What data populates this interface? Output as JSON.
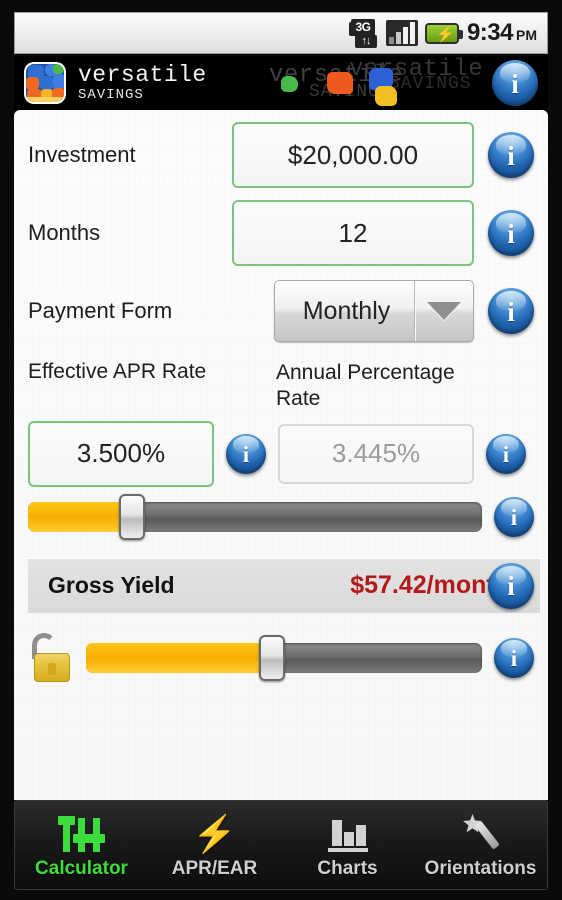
{
  "statusbar": {
    "network_icon": "3g-icon",
    "network_label": "3G",
    "signal_icon": "signal-bars-icon",
    "battery_icon": "battery-charging-icon",
    "time": "9:34",
    "ampm": "PM"
  },
  "header": {
    "logo_icon": "app-logo-icon",
    "brand_line1": "versatile",
    "brand_line2": "SAVINGS",
    "ghost_line1": "versatile",
    "ghost_line2": "SAVINGS",
    "ghost_line3": "versatile",
    "ghost_line4": "SAVINGS",
    "info_icon": "info-icon"
  },
  "form": {
    "investment": {
      "label": "Investment",
      "value": "$20,000.00",
      "info_icon": "info-icon"
    },
    "months": {
      "label": "Months",
      "value": "12",
      "info_icon": "info-icon"
    },
    "payment_form": {
      "label": "Payment Form",
      "value": "Monthly",
      "dropdown_icon": "chevron-down-icon",
      "info_icon": "info-icon",
      "options": [
        "Monthly"
      ]
    },
    "effective_apr": {
      "label": "Effective APR Rate",
      "value": "3.500%",
      "info_icon": "info-icon"
    },
    "annual_percentage": {
      "label": "Annual Percentage Rate",
      "value": "3.445%",
      "info_icon": "info-icon"
    },
    "rate_slider": {
      "name": "rate-slider",
      "percent": 23,
      "fill_color": "#F5AE00",
      "track_color": "#6D6D6D",
      "info_icon": "info-icon"
    },
    "gross_yield": {
      "label": "Gross Yield",
      "value": "$57.42/month",
      "value_color": "#B31919",
      "info_icon": "info-icon"
    },
    "lock_slider": {
      "lock_icon": "unlocked-padlock-icon",
      "percent": 47,
      "fill_color": "#F5AE00",
      "track_color": "#6D6D6D",
      "info_icon": "info-icon"
    }
  },
  "tabbar": {
    "tabs": [
      {
        "label": "Calculator",
        "icon": "faders-icon",
        "active": true
      },
      {
        "label": "APR/EAR",
        "icon": "lightning-icon",
        "active": false
      },
      {
        "label": "Charts",
        "icon": "bar-chart-icon",
        "active": false
      },
      {
        "label": "Orientations",
        "icon": "magic-wand-icon",
        "active": false
      }
    ],
    "active_color": "#3DDC3D",
    "inactive_color": "#CFCFCF"
  }
}
